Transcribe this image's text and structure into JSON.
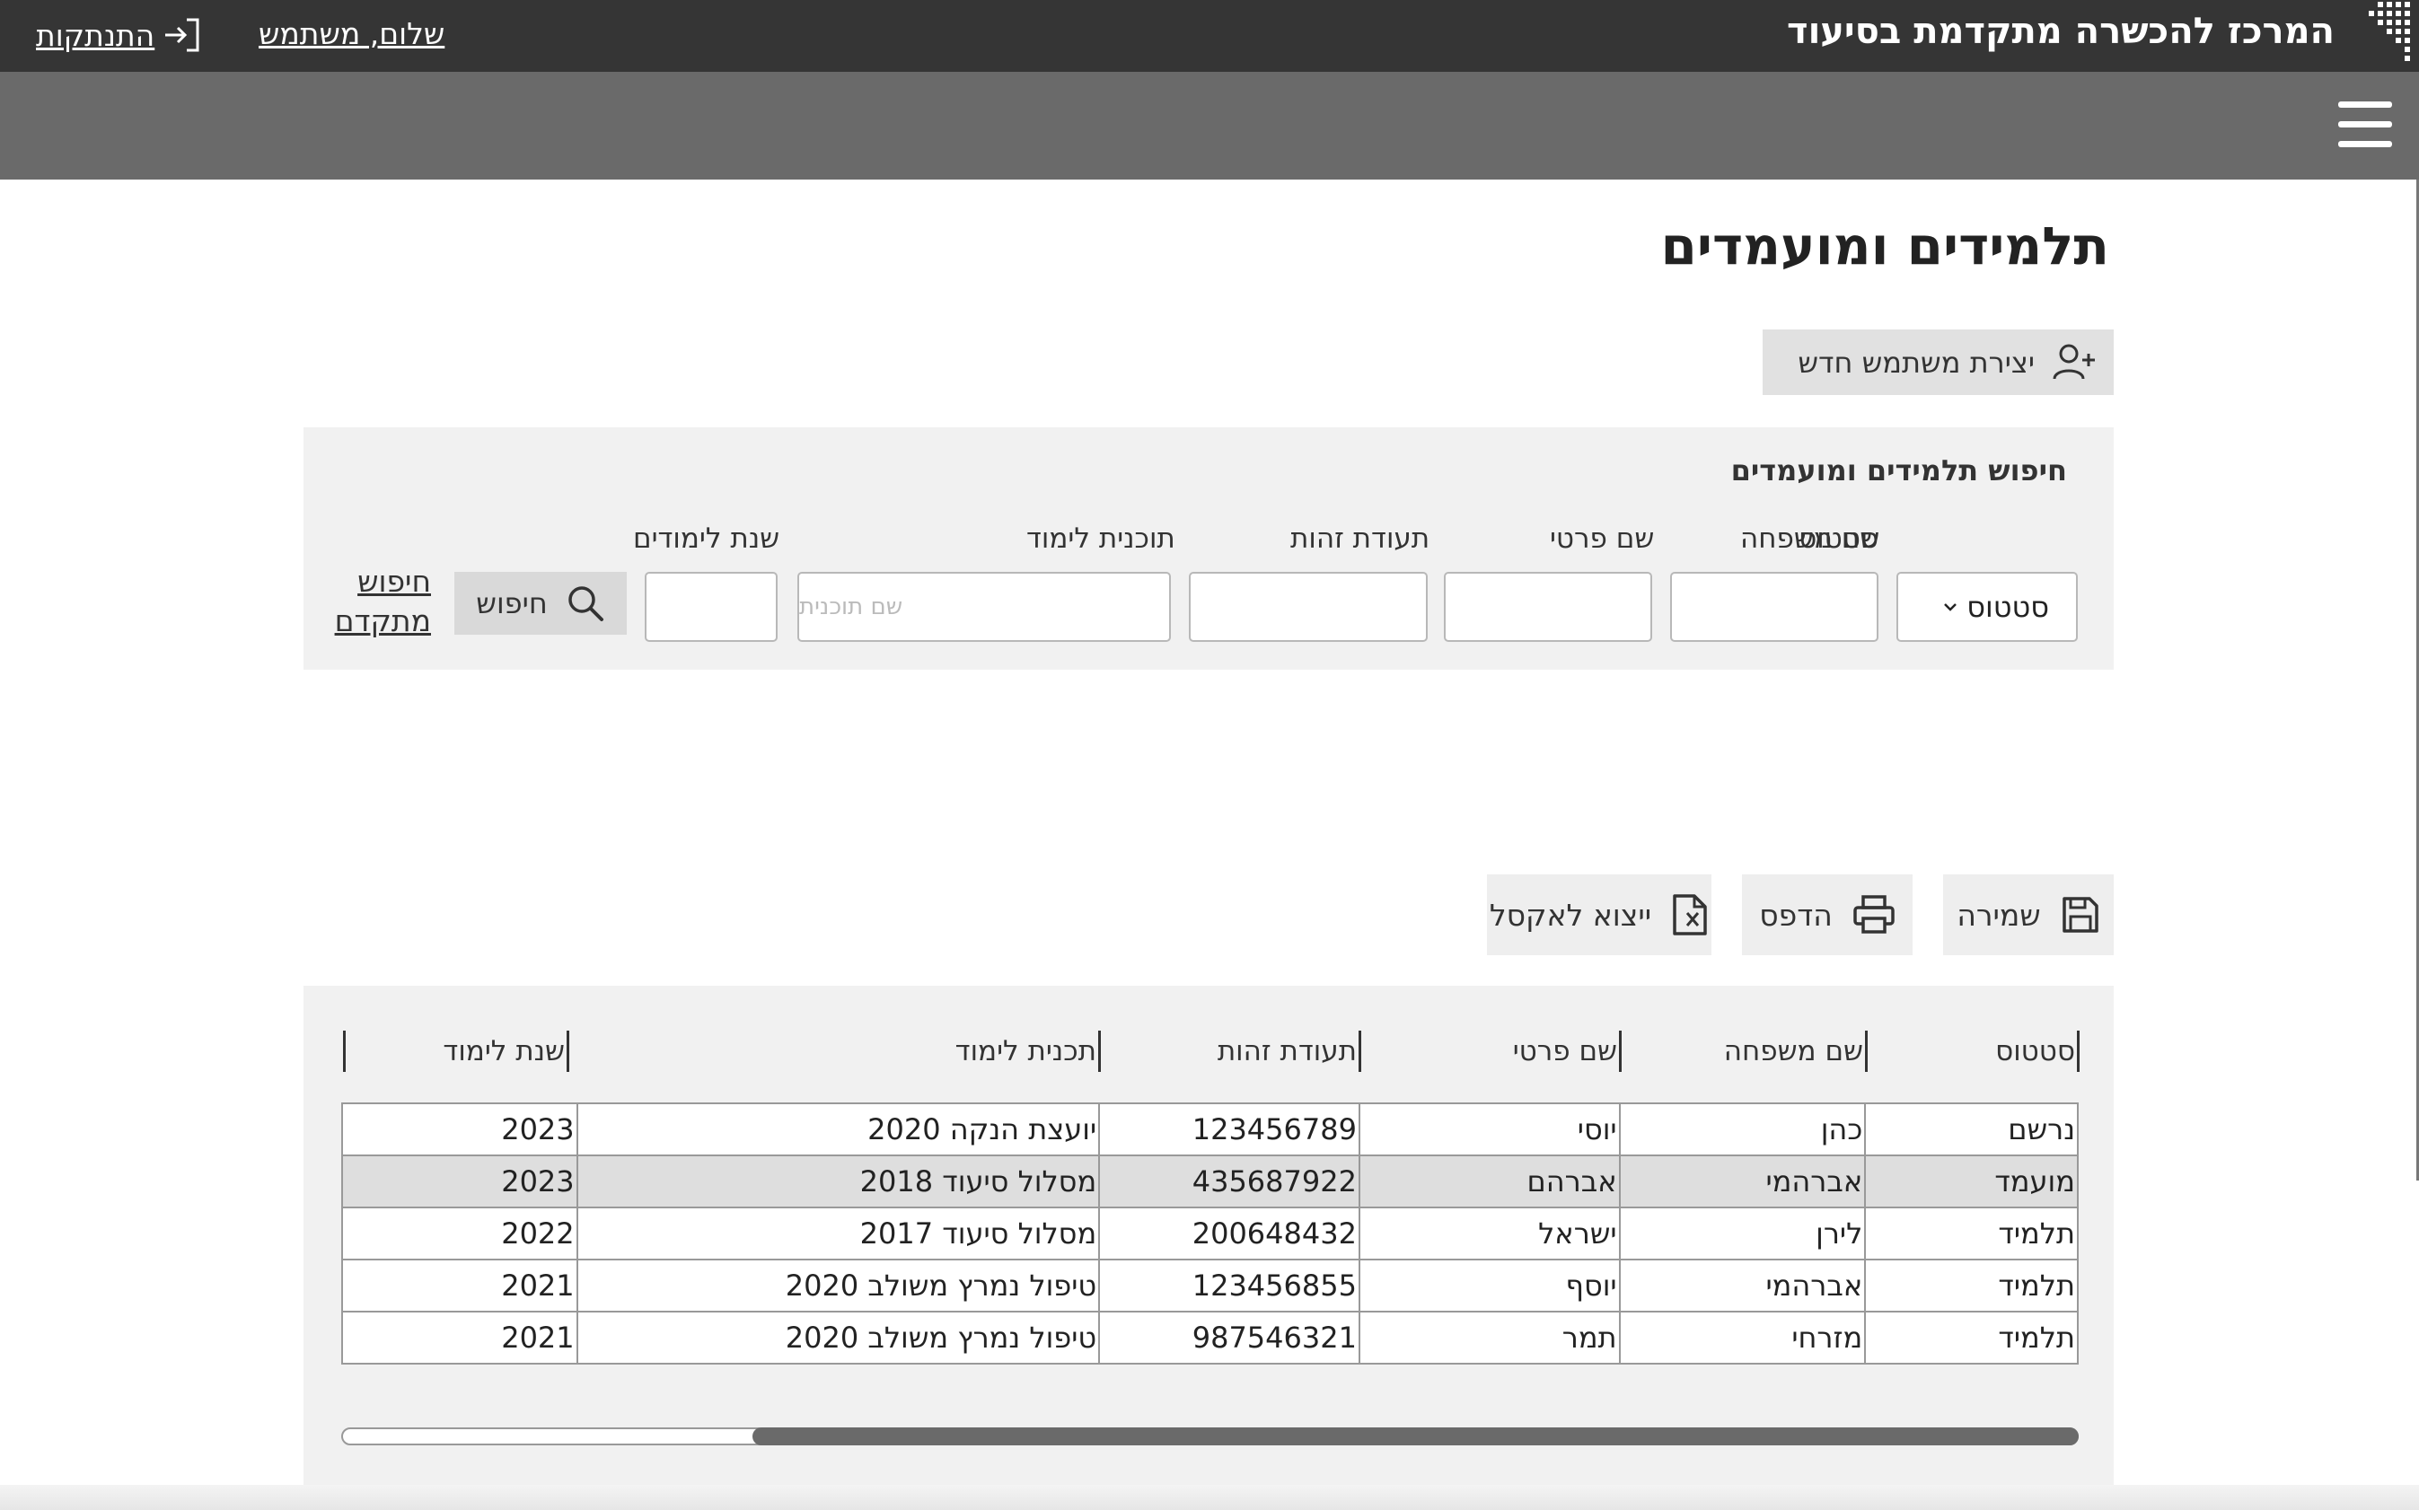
{
  "header": {
    "site_title": "המרכז להכשרה מתקדמת בסיעוד",
    "greeting": "שלום, משתמש",
    "logout_label": "התנתקות"
  },
  "page": {
    "title": "תלמידים ומועמדים",
    "create_user_label": "יצירת משתמש חדש"
  },
  "search": {
    "title": "חיפוש תלמידים ומועמדים",
    "labels": {
      "status": "סטטוס",
      "last_name": "שם משפחה",
      "first_name": "שם פרטי",
      "id_number": "תעודת זהות",
      "program": "תוכנית לימוד",
      "year": "שנת לימודים"
    },
    "status_value": "סטטוס",
    "program_placeholder": "שם תוכנית",
    "search_button": "חיפוש",
    "advanced_search": "חיפוש מתקדם"
  },
  "toolbar": {
    "save_label": "שמירה",
    "print_label": "הדפס",
    "export_label": "ייצוא לאקסל"
  },
  "table": {
    "headers": [
      "סטטוס",
      "שם משפחה",
      "שם פרטי",
      "תעודת זהות",
      "תכנית לימוד",
      "שנת לימוד"
    ],
    "rows": [
      [
        "נרשם",
        "כהן",
        "יוסי",
        "123456789",
        "יועצת הנקה 2020",
        "2023"
      ],
      [
        "מועמד",
        "אברהמי",
        "אברהם",
        "435687922",
        "מסלול סיעוד 2018",
        "2023"
      ],
      [
        "תלמיד",
        "לירן",
        "ישראל",
        "200648432",
        "מסלול סיעוד 2017",
        "2022"
      ],
      [
        "תלמיד",
        "אברהמי",
        "יוסף",
        "123456855",
        "טיפול נמרץ משולב 2020",
        "2021"
      ],
      [
        "תלמיד",
        "מזרחי",
        "תמר",
        "987546321",
        "טיפול נמרץ משולב 2020",
        "2021"
      ]
    ],
    "selected_row": 1
  }
}
